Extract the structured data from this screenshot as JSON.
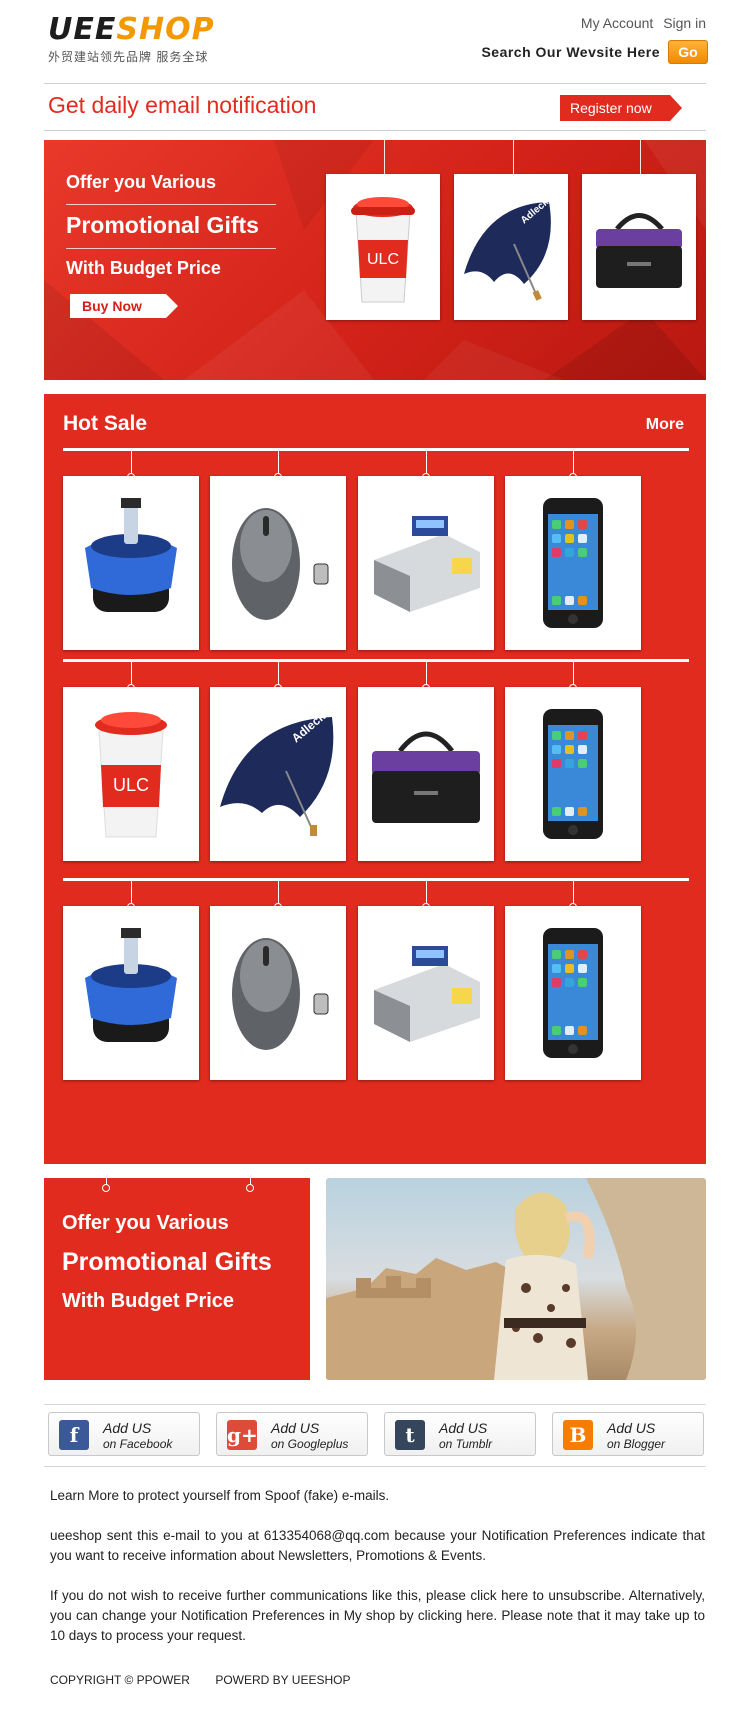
{
  "header": {
    "logo_main_1": "UEE",
    "logo_main_2": "SHOP",
    "logo_sub": "外贸建站领先品牌 服务全球",
    "my_account": "My Account",
    "sign_in": "Sign in",
    "search_label": "Search Our Wevsite Here",
    "go_label": "Go"
  },
  "notify": {
    "text": "Get daily email notification",
    "register_label": "Register now"
  },
  "banner": {
    "line1": "Offer you Various",
    "line2": "Promotional Gifts",
    "line3": "With Budget Price",
    "buy_label": "Buy Now",
    "products": [
      "mug-icon",
      "umbrella-icon",
      "bag-icon"
    ]
  },
  "hot_sale": {
    "title": "Hot Sale",
    "more_label": "More",
    "rows": [
      [
        "speaker-icon",
        "mouse-icon",
        "money-counter-icon",
        "phone-icon"
      ],
      [
        "mug-icon",
        "umbrella-icon",
        "bag-icon",
        "phone-icon"
      ],
      [
        "speaker-icon",
        "mouse-icon",
        "money-counter-icon",
        "phone-icon"
      ]
    ]
  },
  "promo2": {
    "line1": "Offer you Various",
    "line2": "Promotional Gifts",
    "line3": "With Budget Price"
  },
  "social": [
    {
      "line1": "Add US",
      "line2": "on Facebook",
      "glyph": "f",
      "color": "#3b5998",
      "icon": "facebook-icon"
    },
    {
      "line1": "Add US",
      "line2": "on Googleplus",
      "glyph": "g+",
      "color": "#dd4b39",
      "icon": "googleplus-icon"
    },
    {
      "line1": "Add US",
      "line2": "on Tumblr",
      "glyph": "t",
      "color": "#35465c",
      "icon": "tumblr-icon"
    },
    {
      "line1": "Add US",
      "line2": "on Blogger",
      "glyph": "B",
      "color": "#f57d00",
      "icon": "blogger-icon"
    }
  ],
  "footer": {
    "p1": "Learn More to protect yourself from Spoof (fake) e-mails.",
    "p2": "ueeshop sent this e-mail to you at 613354068@qq.com because your Notification Preferences indicate that you want to receive information about Newsletters, Promotions & Events.",
    "p3": "If you do not wish to receive further communications like this, please click here to unsubscribe. Alternatively, you can change your Notification Preferences in My shop by clicking here. Please note that it may take up to 10 days to process your request.",
    "copyright": "COPYRIGHT © PPOWER",
    "powered": "POWERD BY UEESHOP"
  },
  "colors": {
    "brand_red": "#e22b1f",
    "logo_orange": "#f39800"
  }
}
